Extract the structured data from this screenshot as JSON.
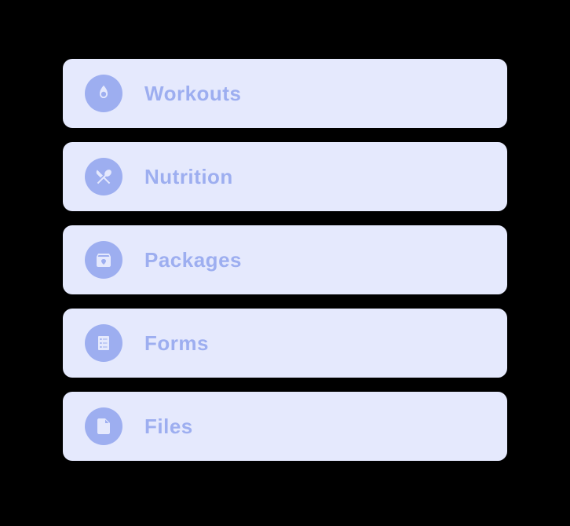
{
  "menu": {
    "items": [
      {
        "label": "Workouts",
        "icon": "fire-icon"
      },
      {
        "label": "Nutrition",
        "icon": "utensils-icon"
      },
      {
        "label": "Packages",
        "icon": "package-icon"
      },
      {
        "label": "Forms",
        "icon": "form-icon"
      },
      {
        "label": "Files",
        "icon": "file-icon"
      }
    ]
  }
}
